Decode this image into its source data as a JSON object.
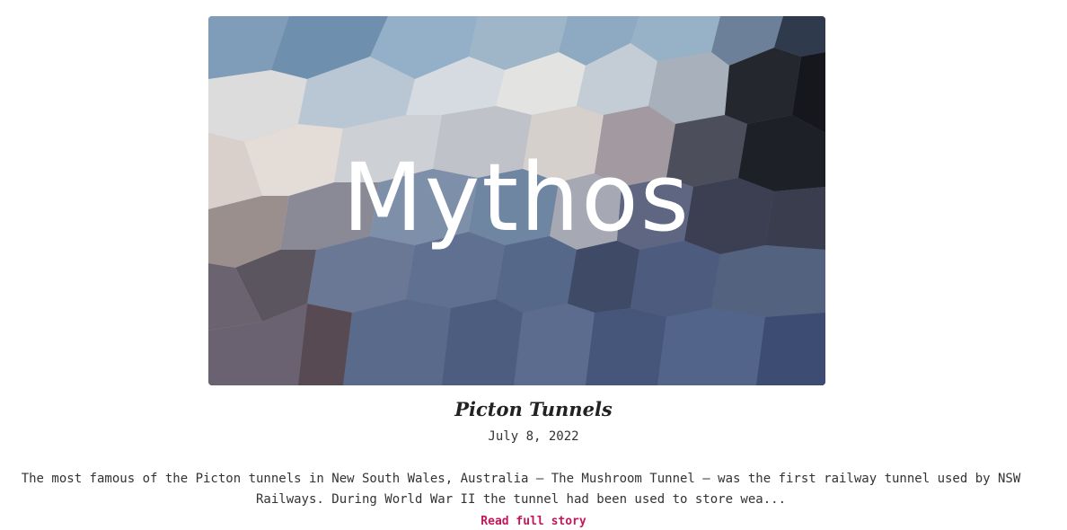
{
  "post": {
    "image_logo_text": "Mythos",
    "title": "Picton Tunnels",
    "date": "July 8, 2022",
    "excerpt": "The most famous of the Picton tunnels in New South Wales, Australia – The Mushroom Tunnel – was the first railway tunnel used by NSW Railways. During World War II the tunnel had been used to store wea...",
    "read_more_label": "Read full story"
  },
  "colors": {
    "link": "#c2185b",
    "text": "#333333",
    "background": "#ffffff"
  }
}
